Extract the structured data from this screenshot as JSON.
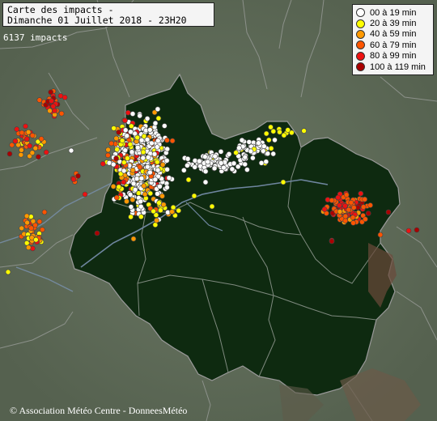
{
  "title": {
    "line1": "Carte des impacts -",
    "line2": "Dimanche 01 Juillet 2018 - 23H20"
  },
  "impact_count": "6137 impacts",
  "legend": [
    {
      "label": "00 à 19 min",
      "color": "#ffffff"
    },
    {
      "label": "20 à 39 min",
      "color": "#ffff00"
    },
    {
      "label": "40 à 59 min",
      "color": "#ff9900"
    },
    {
      "label": "60 à 79 min",
      "color": "#ff5500"
    },
    {
      "label": "80 à 99 min",
      "color": "#ee1111"
    },
    {
      "label": "100 à 119 min",
      "color": "#aa0000"
    }
  ],
  "credit": "© Association Météo Centre - DonneesMétéo",
  "colors": {
    "background": "#5e6b5a",
    "region_fill": "#0e2a10",
    "borders": "#8a8a8a",
    "rivers": "#6f86a0"
  }
}
